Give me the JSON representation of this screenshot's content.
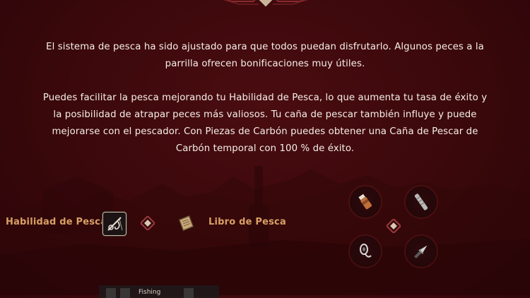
{
  "content": {
    "paragraph_1": "El sistema de pesca ha sido ajustado para que todos puedan disfrutarlo. Algunos peces a la parrilla ofrecen bonificaciones muy útiles.",
    "paragraph_2": "Puedes facilitar la pesca mejorando tu Habilidad de Pesca, lo que aumenta tu tasa de éxito y la posibilidad de atrapar peces más valiosos. Tu caña de pescar también influye y puede mejorarse con el pescador. Con Piezas de Carbón puedes obtener una Caña de Pescar de Carbón temporal con 100 % de éxito."
  },
  "skill_row": {
    "skill_label": "Habilidad de Pesca",
    "skill_icon": "fishing-rod-hook-icon",
    "book_label": "Libro de Pesca",
    "book_icon": "fishing-book-icon"
  },
  "tools": [
    {
      "icon": "bait-bottle-icon"
    },
    {
      "icon": "fishing-rod-reel-icon"
    },
    {
      "icon": "hook-lure-icon"
    },
    {
      "icon": "fishing-knife-icon"
    }
  ],
  "bottom_hud": {
    "text": "Fishing"
  },
  "colors": {
    "background": "#3a080b",
    "accent_gold": "#d9a064",
    "text": "#f6eee8"
  }
}
